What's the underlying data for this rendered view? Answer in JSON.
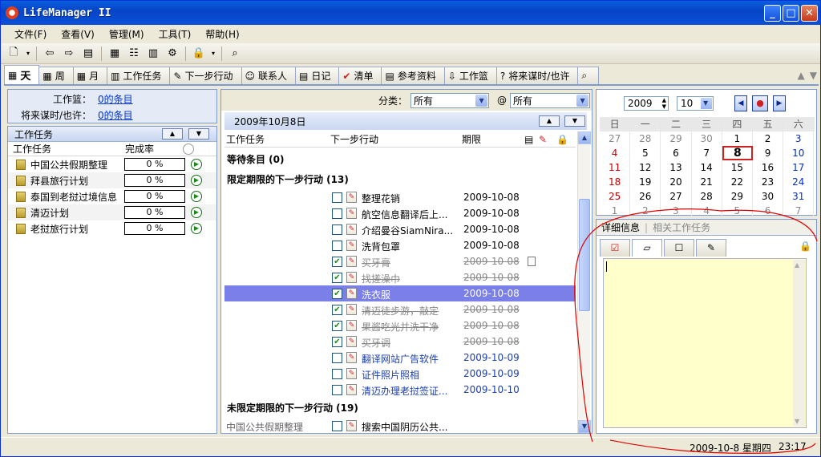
{
  "window": {
    "title": "LifeManager II",
    "minimize": "_",
    "maximize": "□",
    "close": "✕"
  },
  "menu": [
    {
      "label": "文件(F)"
    },
    {
      "label": "查看(V)"
    },
    {
      "label": "管理(M)"
    },
    {
      "label": "工具(T)"
    },
    {
      "label": "帮助(H)"
    }
  ],
  "tabs": [
    {
      "label": "天",
      "icon": "calendar-day-icon"
    },
    {
      "label": "周",
      "icon": "calendar-week-icon"
    },
    {
      "label": "月",
      "icon": "calendar-month-icon"
    },
    {
      "label": "工作任务",
      "icon": "task-icon"
    },
    {
      "label": "下一步行动",
      "icon": "next-action-icon"
    },
    {
      "label": "联系人",
      "icon": "contact-icon"
    },
    {
      "label": "日记",
      "icon": "diary-icon"
    },
    {
      "label": "清单",
      "icon": "checklist-icon"
    },
    {
      "label": "参考资料",
      "icon": "reference-icon"
    },
    {
      "label": "工作篮",
      "icon": "inbox-icon"
    },
    {
      "label": "将来谋时/也许",
      "icon": "someday-icon"
    },
    {
      "label": "",
      "icon": "search-icon"
    }
  ],
  "left_summary": {
    "inbox_label": "工作篮：",
    "inbox_value": "0的条目",
    "someday_label": "将来谋时/也许：",
    "someday_value": "0的条目"
  },
  "task_panel": {
    "header": "工作任务",
    "col_task": "工作任务",
    "col_rate": "完成率",
    "tasks": [
      {
        "name": "中国公共假期整理",
        "rate": "0 %"
      },
      {
        "name": "拜县旅行计划",
        "rate": "0 %"
      },
      {
        "name": "泰国到老挝过境信息",
        "rate": "0 %"
      },
      {
        "name": "清迈计划",
        "rate": "0 %"
      },
      {
        "name": "老挝旅行计划",
        "rate": "0 %"
      }
    ]
  },
  "filter": {
    "category_label": "分类：",
    "category_value": "所有",
    "at_label": "@",
    "context_value": "所有"
  },
  "day_view": {
    "date_header": "2009年10月8日",
    "col_task": "工作任务",
    "col_next": "下一步行动",
    "col_due": "期限",
    "groups": {
      "waiting": "等待条目 (0)",
      "dated": "限定期限的下一步行动 (13)",
      "undated": "未限定期限的下一步行动 (19)"
    },
    "dated_items": [
      {
        "title": "整理花销",
        "date": "2009-10-08",
        "checked": false,
        "state": "normal"
      },
      {
        "title": "航空信息翻译后上...",
        "date": "2009-10-08",
        "checked": false,
        "state": "normal"
      },
      {
        "title": "介绍曼谷SiamNira...",
        "date": "2009-10-08",
        "checked": false,
        "state": "normal"
      },
      {
        "title": "洗背包罩",
        "date": "2009-10-08",
        "checked": false,
        "state": "normal"
      },
      {
        "title": "买牙膏",
        "date": "2009-10-08",
        "checked": true,
        "state": "done"
      },
      {
        "title": "找搓澡巾",
        "date": "2009-10-08",
        "checked": true,
        "state": "done"
      },
      {
        "title": "洗衣服",
        "date": "2009-10-08",
        "checked": true,
        "state": "selected"
      },
      {
        "title": "清迈徒步游，敲定",
        "date": "2009-10-08",
        "checked": true,
        "state": "done"
      },
      {
        "title": "果酱吃光并洗干净",
        "date": "2009-10-08",
        "checked": true,
        "state": "done"
      },
      {
        "title": "买牙调",
        "date": "2009-10-08",
        "checked": true,
        "state": "done"
      },
      {
        "title": "翻译网站广告软件",
        "date": "2009-10-09",
        "checked": false,
        "state": "future"
      },
      {
        "title": "证件照片照相",
        "date": "2009-10-09",
        "checked": false,
        "state": "future"
      },
      {
        "title": "清迈办理老挝签证...",
        "date": "2009-10-10",
        "checked": false,
        "state": "future"
      }
    ],
    "undated_items": [
      {
        "owner": "中国公共假期整理",
        "title": "搜索中国阴历公共...",
        "checked": false
      }
    ]
  },
  "calendar": {
    "year": "2009",
    "month": "10",
    "weekdays": [
      "日",
      "一",
      "二",
      "三",
      "四",
      "五",
      "六"
    ],
    "weeks": [
      [
        "27",
        "28",
        "29",
        "30",
        "1",
        "2",
        "3"
      ],
      [
        "4",
        "5",
        "6",
        "7",
        "8",
        "9",
        "10"
      ],
      [
        "11",
        "12",
        "13",
        "14",
        "15",
        "16",
        "17"
      ],
      [
        "18",
        "19",
        "20",
        "21",
        "22",
        "23",
        "24"
      ],
      [
        "25",
        "26",
        "27",
        "28",
        "29",
        "30",
        "31"
      ],
      [
        "1",
        "2",
        "3",
        "4",
        "5",
        "6",
        "7"
      ]
    ],
    "today": "8"
  },
  "detail": {
    "tab_detail": "详细信息",
    "tab_related": "相关工作任务"
  },
  "status": {
    "date": "2009-10-8 星期四",
    "time": "23:17"
  },
  "colors": {
    "accent": "#0a50d8",
    "selected_row": "#7b7fe8",
    "note_bg": "#ffffcc",
    "annotation": "#e00000"
  }
}
